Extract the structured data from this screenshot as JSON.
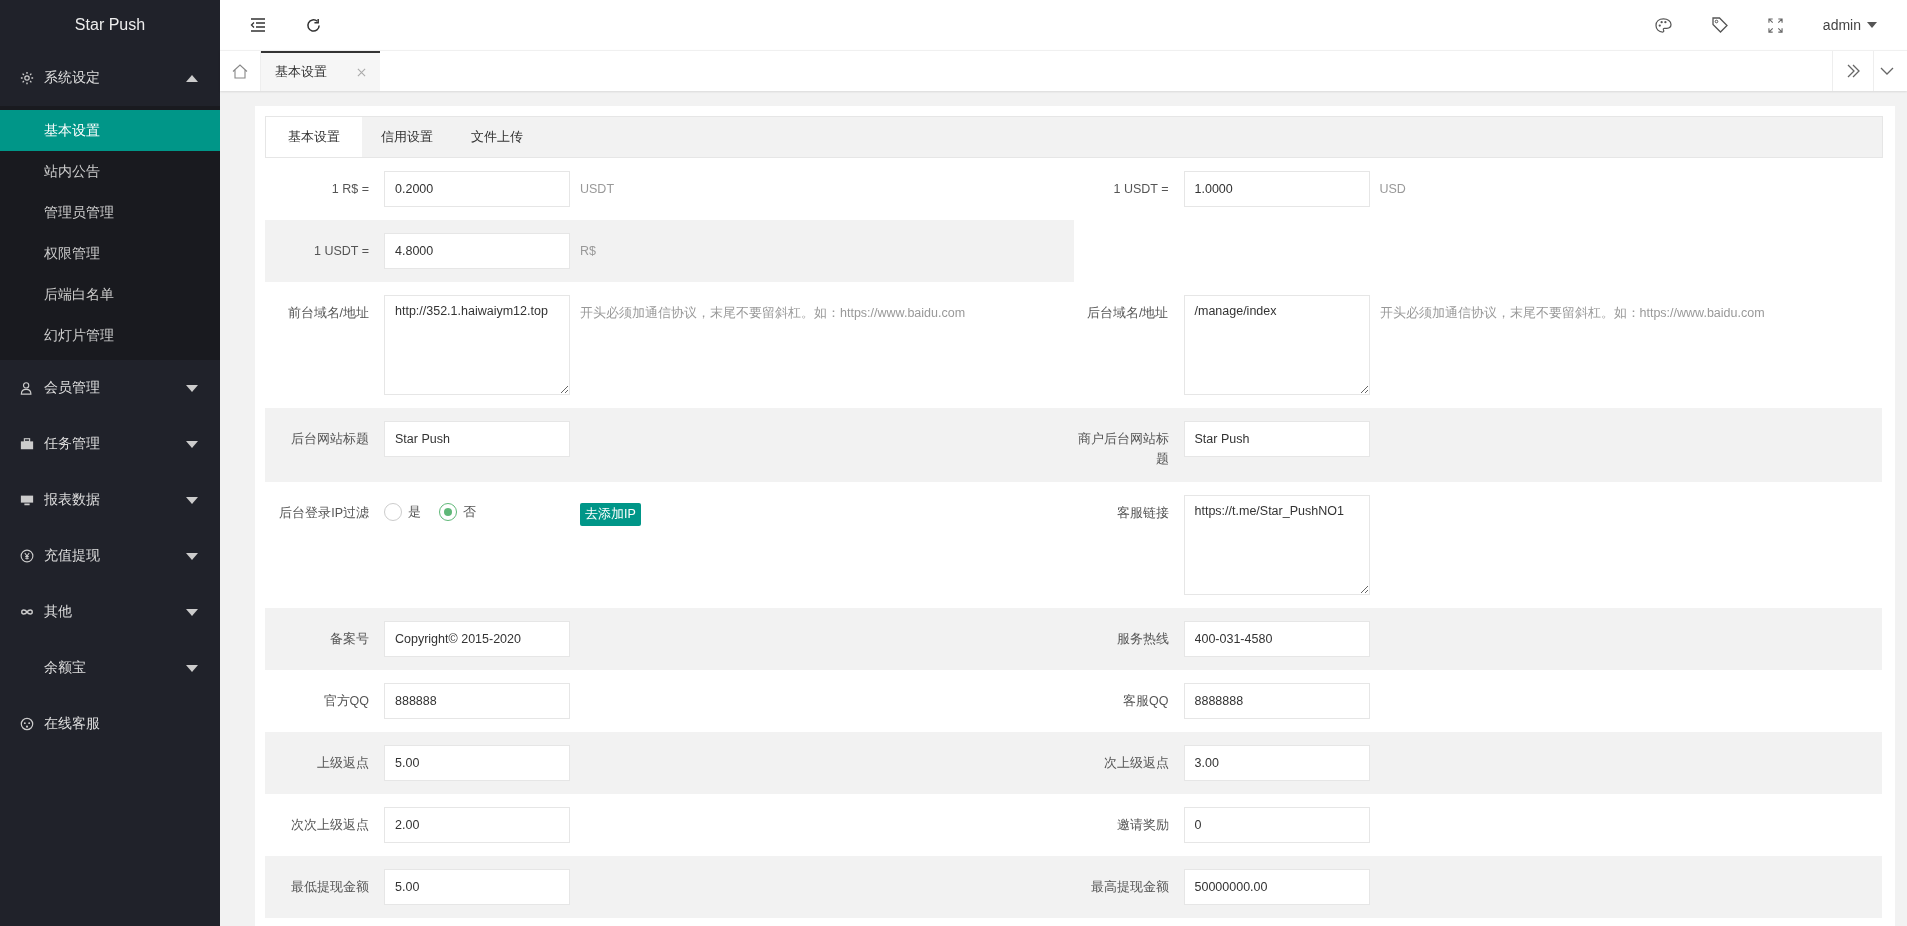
{
  "sidebar": {
    "logo": "Star Push",
    "menu": [
      {
        "label": "系统设定",
        "expanded": true,
        "children": [
          {
            "label": "基本设置",
            "selected": true
          },
          {
            "label": "站内公告",
            "selected": false
          },
          {
            "label": "管理员管理",
            "selected": false
          },
          {
            "label": "权限管理",
            "selected": false
          },
          {
            "label": "后端白名单",
            "selected": false
          },
          {
            "label": "幻灯片管理",
            "selected": false
          }
        ]
      },
      {
        "label": "会员管理",
        "expanded": false
      },
      {
        "label": "任务管理",
        "expanded": false
      },
      {
        "label": "报表数据",
        "expanded": false
      },
      {
        "label": "充值提现",
        "expanded": false
      },
      {
        "label": "其他",
        "expanded": false
      },
      {
        "label": "余额宝",
        "expanded": false
      },
      {
        "label": "在线客服"
      }
    ]
  },
  "header": {
    "user": "admin"
  },
  "page_tabs": [
    {
      "label": "基本设置",
      "selected": true
    }
  ],
  "form_tabs": [
    {
      "label": "基本设置",
      "selected": true
    },
    {
      "label": "信用设置",
      "selected": false
    },
    {
      "label": "文件上传",
      "selected": false
    }
  ],
  "form_rows": [
    {
      "shaded": false,
      "left": {
        "label": "1 R$ =",
        "kind": "input",
        "value": "0.2000",
        "suffix": "USDT"
      },
      "right": {
        "label": "1 USDT =",
        "kind": "input",
        "value": "1.0000",
        "suffix": "USD"
      }
    },
    {
      "shaded": true,
      "left": {
        "label": "1 USDT =",
        "kind": "input",
        "value": "4.8000",
        "suffix": "R$"
      }
    },
    {
      "shaded": false,
      "left": {
        "label": "前台域名/地址",
        "kind": "textarea",
        "value": "http://352.1.haiwaiym12.top",
        "hint": "开头必须加通信协议，末尾不要留斜杠。如：https://www.baidu.com"
      },
      "right": {
        "label": "后台域名/地址",
        "kind": "textarea",
        "value": "/manage/index",
        "hint": "开头必须加通信协议，末尾不要留斜杠。如：https://www.baidu.com"
      }
    },
    {
      "shaded": true,
      "left": {
        "label": "后台网站标题",
        "kind": "input",
        "value": "Star Push"
      },
      "right": {
        "label": "商户后台网站标题",
        "kind": "input",
        "value": "Star Push"
      }
    },
    {
      "shaded": false,
      "left": {
        "label": "后台登录IP过滤",
        "kind": "radio",
        "options": [
          {
            "label": "是",
            "selected": false
          },
          {
            "label": "否",
            "selected": true
          }
        ],
        "button": "去添加IP"
      },
      "right": {
        "label": "客服链接",
        "kind": "textarea",
        "value": "https://t.me/Star_PushNO1"
      }
    },
    {
      "shaded": true,
      "left": {
        "label": "备案号",
        "kind": "input",
        "value": "Copyright© 2015-2020"
      },
      "right": {
        "label": "服务热线",
        "kind": "input",
        "value": "400-031-4580"
      }
    },
    {
      "shaded": false,
      "left": {
        "label": "官方QQ",
        "kind": "input",
        "value": "888888"
      },
      "right": {
        "label": "客服QQ",
        "kind": "input",
        "value": "8888888"
      }
    },
    {
      "shaded": true,
      "left": {
        "label": "上级返点",
        "kind": "input",
        "value": "5.00"
      },
      "right": {
        "label": "次上级返点",
        "kind": "input",
        "value": "3.00"
      }
    },
    {
      "shaded": false,
      "left": {
        "label": "次次上级返点",
        "kind": "input",
        "value": "2.00"
      },
      "right": {
        "label": "邀请奖励",
        "kind": "input",
        "value": "0"
      }
    },
    {
      "shaded": true,
      "left": {
        "label": "最低提现金额",
        "kind": "input",
        "value": "5.00"
      },
      "right": {
        "label": "最高提现金额",
        "kind": "input",
        "value": "50000000.00"
      }
    }
  ]
}
